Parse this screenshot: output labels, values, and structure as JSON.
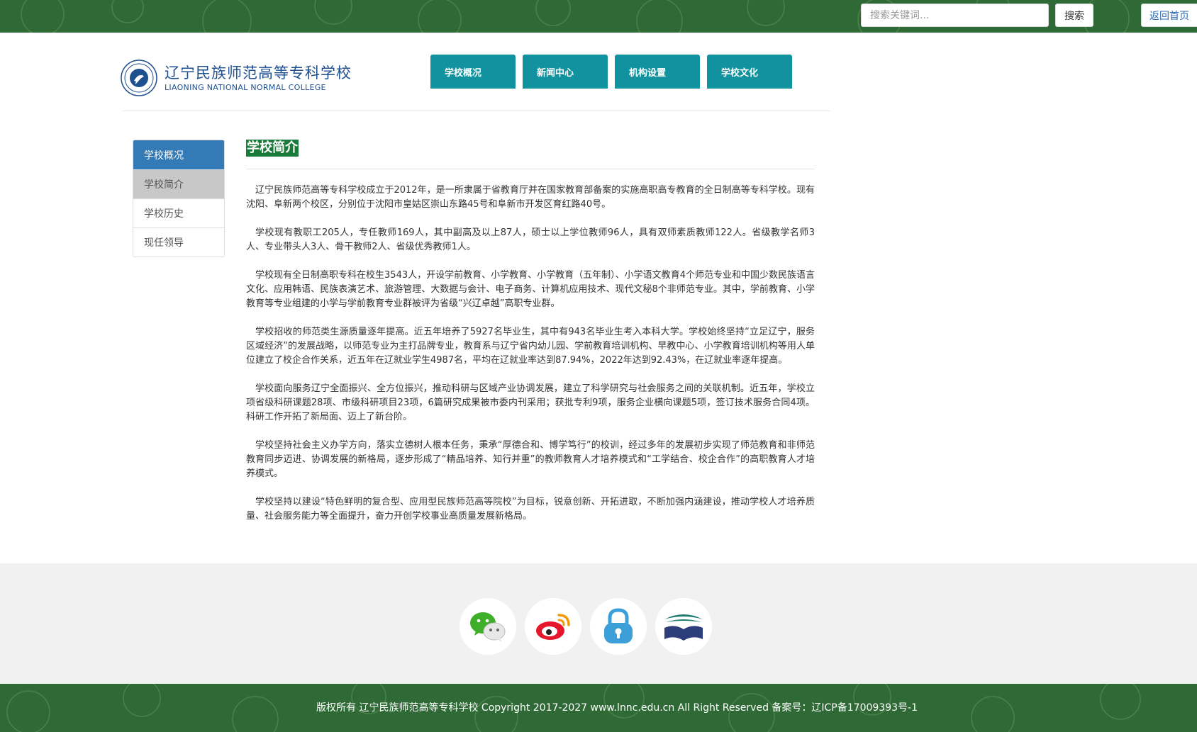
{
  "topbar": {
    "search_placeholder": "搜索关键词...",
    "search_label": "搜索",
    "home_label": "返回首页"
  },
  "header": {
    "logo_cn": "辽宁民族师范高等专科学校",
    "logo_en": "LIAONING NATIONAL NORMAL COLLEGE",
    "nav": [
      {
        "label": "学校概况"
      },
      {
        "label": "新闻中心"
      },
      {
        "label": "机构设置"
      },
      {
        "label": "学校文化"
      }
    ]
  },
  "sidebar": {
    "title": "学校概况",
    "items": [
      {
        "label": "学校简介",
        "active": true
      },
      {
        "label": "学校历史",
        "active": false
      },
      {
        "label": "现任领导",
        "active": false
      }
    ]
  },
  "content": {
    "title": "学校简介",
    "paragraphs": [
      "辽宁民族师范高等专科学校成立于2012年，是一所隶属于省教育厅并在国家教育部备案的实施高职高专教育的全日制高等专科学校。现有沈阳、阜新两个校区，分别位于沈阳市皇姑区崇山东路45号和阜新市开发区育红路40号。",
      "学校现有教职工205人，专任教师169人，其中副高及以上87人，硕士以上学位教师96人，具有双师素质教师122人。省级教学名师3人、专业带头人3人、骨干教师2人、省级优秀教师1人。",
      "学校现有全日制高职专科在校生3543人，开设学前教育、小学教育、小学教育（五年制）、小学语文教育4个师范专业和中国少数民族语言文化、应用韩语、民族表演艺术、旅游管理、大数据与会计、电子商务、计算机应用技术、现代文秘8个非师范专业。其中，学前教育、小学教育等专业组建的小学与学前教育专业群被评为省级“兴辽卓越”高职专业群。",
      "学校招收的师范类生源质量逐年提高。近五年培养了5927名毕业生，其中有943名毕业生考入本科大学。学校始终坚持“立足辽宁，服务区域经济”的发展战略，以师范专业为主打品牌专业，教育系与辽宁省内幼儿园、学前教育培训机构、早教中心、小学教育培训机构等用人单位建立了校企合作关系，近五年在辽就业学生4987名，平均在辽就业率达到87.94%，2022年达到92.43%，在辽就业率逐年提高。",
      "学校面向服务辽宁全面振兴、全方位振兴，推动科研与区域产业协调发展，建立了科学研究与社会服务之间的关联机制。近五年，学校立项省级科研课题28项、市级科研项目23项，6篇研究成果被市委内刊采用；获批专利9项，服务企业横向课题5项，签订技术服务合同4项。科研工作开拓了新局面、迈上了新台阶。",
      "学校坚持社会主义办学方向，落实立德树人根本任务，秉承“厚德合和、博学笃行”的校训，经过多年的发展初步实现了师范教育和非师范教育同步迈进、协调发展的新格局，逐步形成了“精品培养、知行并重”的教师教育人才培养模式和“工学结合、校企合作”的高职教育人才培养模式。",
      "学校坚持以建设“特色鲜明的复合型、应用型民族师范高等院校”为目标，锐意创新、开拓进取，不断加强内涵建设，推动学校人才培养质量、社会服务能力等全面提升，奋力开创学校事业高质量发展新格局。"
    ]
  },
  "footer": {
    "icons": [
      "wechat-icon",
      "weibo-icon",
      "lock-icon",
      "library-icon"
    ],
    "copyright": "版权所有 辽宁民族师范高等专科学校 Copyright 2017-2027 www.lnnc.edu.cn All Right Reserved 备案号：辽ICP备17009393号-1"
  },
  "colors": {
    "topbar": "#2f6a36",
    "nav": "#11929e",
    "sidebar_head": "#337ab7",
    "title_bg": "#1a7a3a"
  }
}
